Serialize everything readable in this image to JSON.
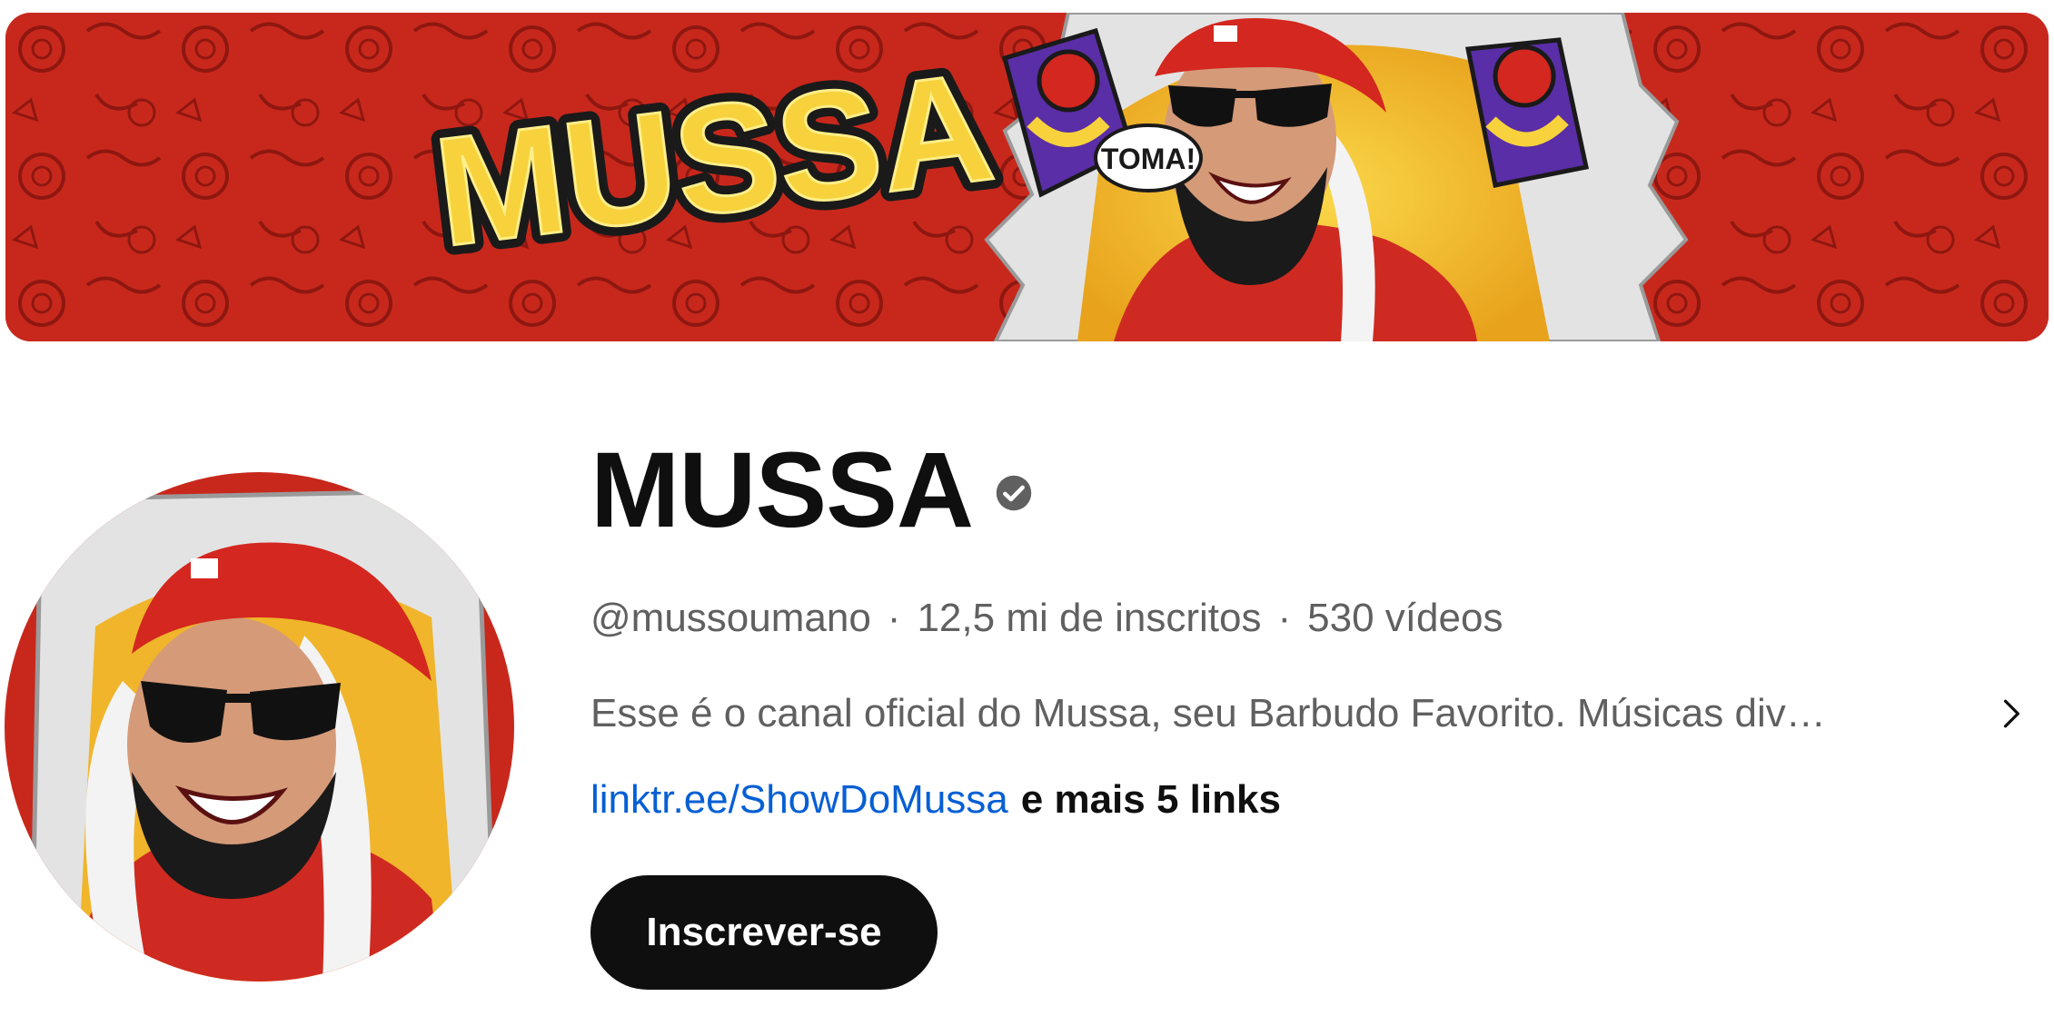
{
  "banner": {
    "logo_text": "MUSSA",
    "speech_text": "TOMA!"
  },
  "channel": {
    "name": "MUSSA",
    "verified_icon": "verified-check-icon",
    "handle": "@mussoumano",
    "subscribers": "12,5 mi de inscritos",
    "videos": "530 vídeos",
    "separator": "·",
    "description": "Esse é o canal oficial do Mussa, seu Barbudo Favorito. Músicas div…",
    "link_text": "linktr.ee/ShowDoMussa",
    "more_links": "e mais 5 links",
    "subscribe_label": "Inscrever-se"
  },
  "colors": {
    "banner_red": "#c8281c",
    "logo_yellow": "#f7d23c",
    "link_blue": "#065fd4",
    "text_primary": "#0f0f0f",
    "text_secondary": "#606060"
  }
}
